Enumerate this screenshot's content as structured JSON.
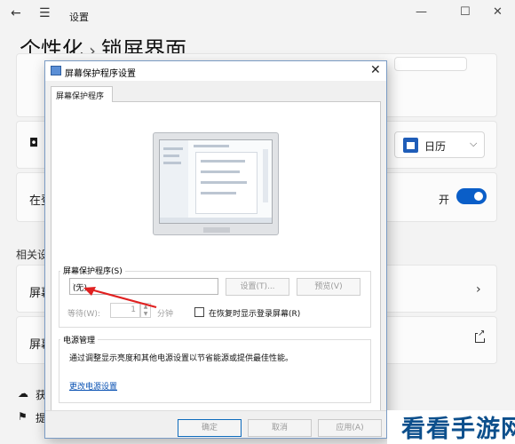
{
  "settings_window": {
    "title": "设置",
    "back_icon": "←",
    "menu_icon": "☰",
    "controls": {
      "minimize": "—",
      "maximize": "☐",
      "close": "✕"
    },
    "breadcrumb": {
      "parent": "个性化",
      "separator": "›",
      "current": "锁屏界面"
    },
    "calendar_dropdown": {
      "value": "日历",
      "icon": "calendar-icon"
    },
    "toggle": {
      "label": "开",
      "state": "on",
      "color": "#0a5ec8"
    },
    "fragments": {
      "row2_prefix": "在登",
      "section_prefix": "相关设",
      "row_a": "屏幕",
      "row_b": "屏幕",
      "bottom_a": "获",
      "bottom_b": "提"
    }
  },
  "dialog": {
    "title": "屏幕保护程序设置",
    "close": "✕",
    "tab_label": "屏幕保护程序",
    "screensaver_group_label": "屏幕保护程序(S)",
    "screensaver_select": {
      "value": "(无)",
      "arrow": "⌵"
    },
    "settings_button": "设置(T)...",
    "preview_button": "预览(V)",
    "wait_label": "等待(W):",
    "wait_value": "1",
    "minute_label": "分钟",
    "resume_checkbox_label": "在恢复时显示登录屏幕(R)",
    "resume_checked": false,
    "power_group_label": "电源管理",
    "power_description": "通过调整显示亮度和其他电源设置以节省能源或提供最佳性能。",
    "power_link": "更改电源设置",
    "ok_button": "确定",
    "cancel_button": "取消",
    "apply_button": "应用(A)"
  },
  "watermark": {
    "text": "看看手游网"
  },
  "accent_color": "#0a5ec8",
  "annotation_color": "#e02020"
}
